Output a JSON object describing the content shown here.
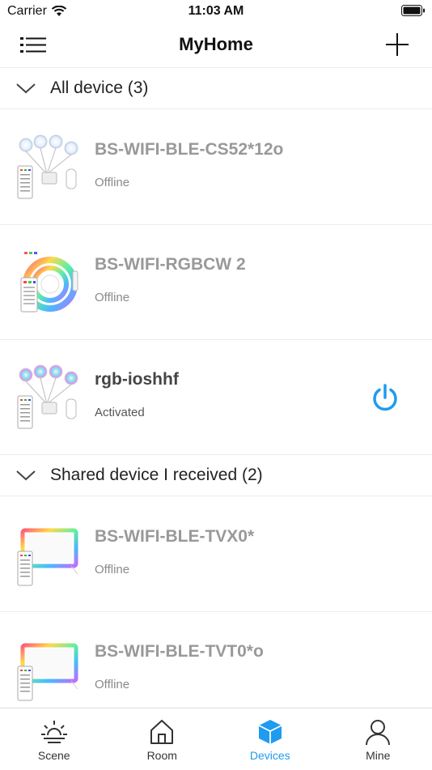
{
  "status_bar": {
    "carrier": "Carrier",
    "time": "11:03 AM"
  },
  "header": {
    "title": "MyHome"
  },
  "sections": [
    {
      "label": "All device (3)",
      "devices": [
        {
          "name": "BS-WIFI-BLE-CS52*12o",
          "status": "Offline",
          "active": false,
          "thumbnail": "puck-lights-kit"
        },
        {
          "name": "BS-WIFI-RGBCW 2",
          "status": "Offline",
          "active": false,
          "thumbnail": "led-strip-reel"
        },
        {
          "name": "rgb-ioshhf",
          "status": "Activated",
          "active": true,
          "thumbnail": "puck-lights-kit-color"
        }
      ]
    },
    {
      "label": "Shared device I received (2)",
      "devices": [
        {
          "name": "BS-WIFI-BLE-TVX0*",
          "status": "Offline",
          "active": false,
          "thumbnail": "tv-backlight-kit"
        },
        {
          "name": "BS-WIFI-BLE-TVT0*o",
          "status": "Offline",
          "active": false,
          "thumbnail": "tv-backlight-kit"
        }
      ]
    }
  ],
  "tabs": [
    {
      "label": "Scene",
      "icon": "sun-horizon-icon",
      "active": false
    },
    {
      "label": "Room",
      "icon": "house-icon",
      "active": false
    },
    {
      "label": "Devices",
      "icon": "cube-icon",
      "active": true
    },
    {
      "label": "Mine",
      "icon": "person-icon",
      "active": false
    }
  ],
  "colors": {
    "accent": "#1f9bf0",
    "inactive_text": "#999999",
    "divider": "#ececec"
  }
}
